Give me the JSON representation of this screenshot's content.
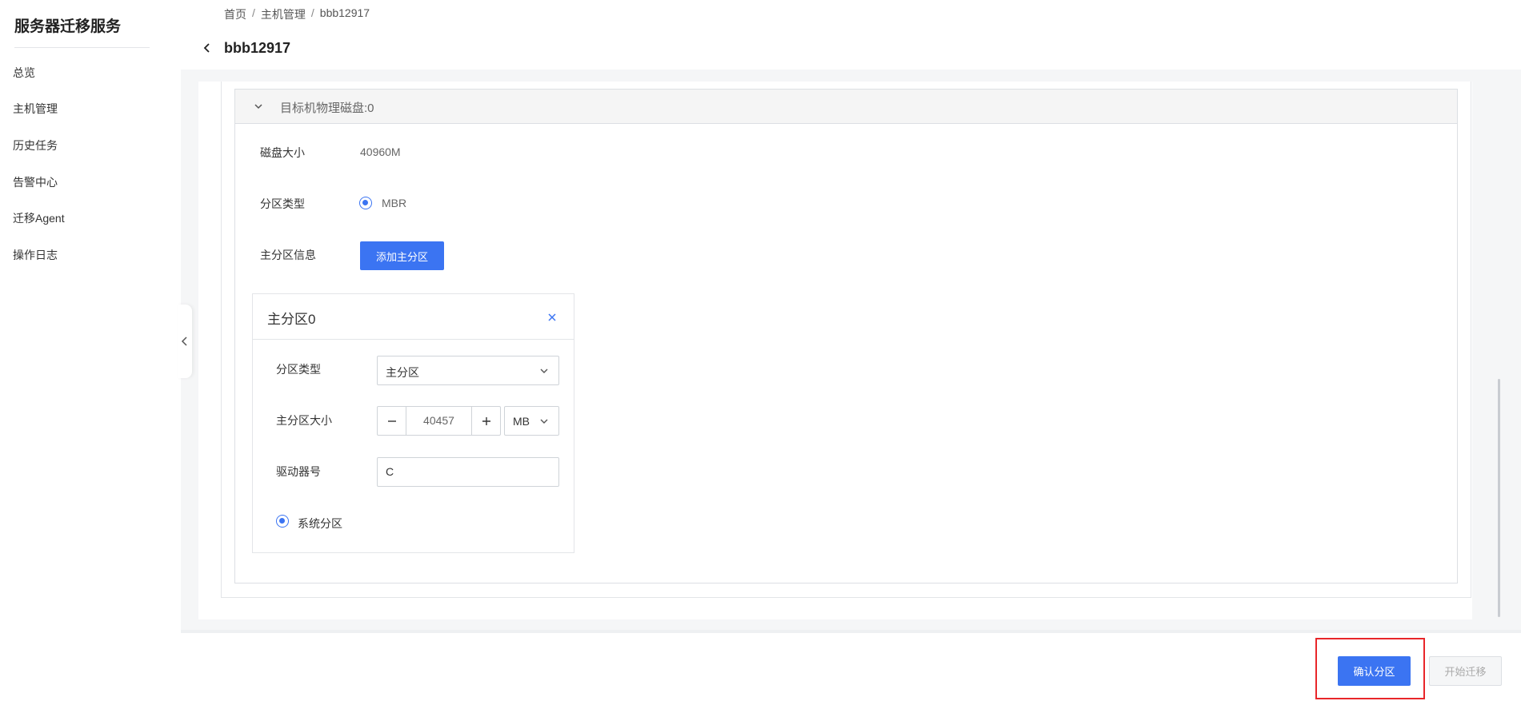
{
  "sidebar": {
    "app_title": "服务器迁移服务",
    "items": [
      {
        "label": "总览"
      },
      {
        "label": "主机管理"
      },
      {
        "label": "历史任务"
      },
      {
        "label": "告警中心"
      },
      {
        "label": "迁移Agent"
      },
      {
        "label": "操作日志"
      }
    ]
  },
  "header": {
    "breadcrumb": [
      "首页",
      "主机管理",
      "bbb12917"
    ],
    "breadcrumb_sep": "/",
    "title": "bbb12917"
  },
  "disk": {
    "header": "目标机物理磁盘:0",
    "size_label": "磁盘大小",
    "size_value": "40960M",
    "partition_type_label": "分区类型",
    "partition_type_value": "MBR",
    "primary_info_label": "主分区信息",
    "add_primary_button": "添加主分区"
  },
  "partition": {
    "title": "主分区0",
    "type_label": "分区类型",
    "type_value": "主分区",
    "size_label": "主分区大小",
    "size_value": "40457",
    "size_unit": "MB",
    "drive_label": "驱动器号",
    "drive_value": "C",
    "system_partition_label": "系统分区"
  },
  "footer": {
    "confirm_button": "确认分区",
    "start_button": "开始迁移"
  },
  "colors": {
    "accent": "#3b74f2",
    "highlight": "#e8262a"
  }
}
